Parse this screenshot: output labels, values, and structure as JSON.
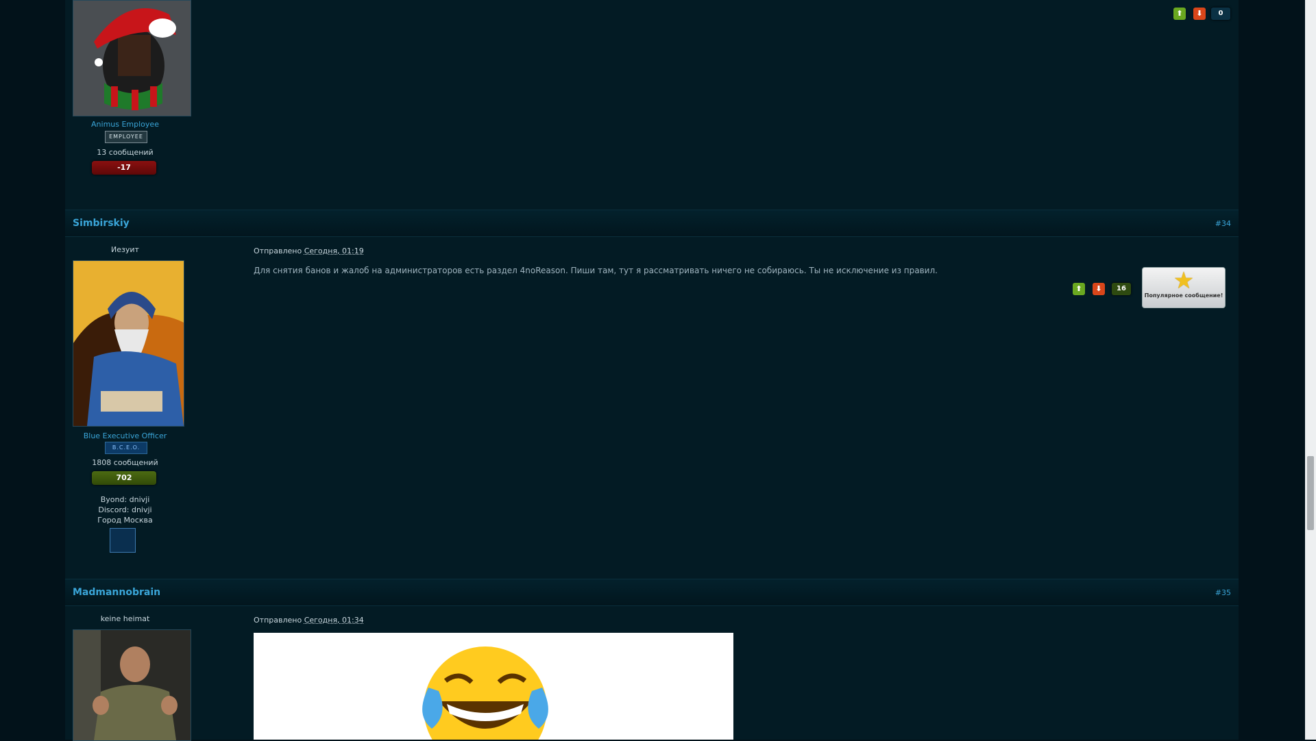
{
  "posts": [
    {
      "rank_name": "Animus Employee",
      "rank_badge": "EMPLOYEE",
      "message_count": "13 сообщений",
      "reputation": "-17",
      "vote_score": "0"
    },
    {
      "author": "Simbirskiy",
      "post_number": "#34",
      "user_title": "Иезуит",
      "rank_name": "Blue Executive Officer",
      "rank_badge": "B.C.E.O.",
      "message_count": "1808 сообщений",
      "reputation": "702",
      "byond": "Byond: dnivji",
      "discord": "Discord: dnivji",
      "city": "Город Москва",
      "posted_label": "Отправлено",
      "posted_date": "Сегодня, 01:19",
      "message": "Для снятия банов и жалоб на администраторов есть раздел 4noReason. Пиши там, тут я рассматривать ничего не собираюсь. Ты не исключение из правил.",
      "vote_score": "16",
      "popular_label": "Популярное сообщение!"
    },
    {
      "author": "Madmannobrain",
      "post_number": "#35",
      "user_title": "keine heimat",
      "posted_label": "Отправлено",
      "posted_date": "Сегодня, 01:34"
    }
  ],
  "icons": {
    "vote_up": "arrow-up-icon",
    "vote_down": "arrow-down-icon",
    "popular": "star-icon"
  },
  "colors": {
    "background": "#02121a",
    "link": "#3aa5d8",
    "vote_up": "#6aa820",
    "vote_down": "#d9461a"
  }
}
